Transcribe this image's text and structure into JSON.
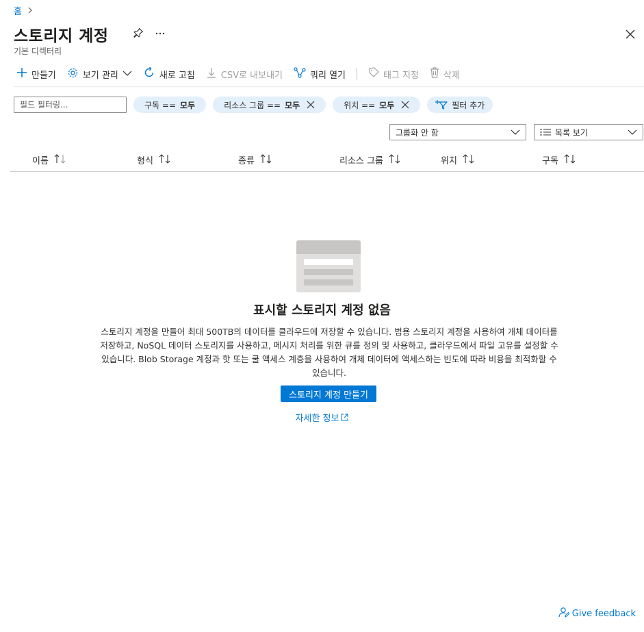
{
  "breadcrumb": {
    "home": "홈"
  },
  "header": {
    "title": "스토리지 계정",
    "subtitle": "기본 디렉터리"
  },
  "toolbar": {
    "create": "만들기",
    "manage_view": "보기 관리",
    "refresh": "새로 고침",
    "export_csv": "CSV로 내보내기",
    "open_query": "쿼리 열기",
    "assign_tags": "태그 지정",
    "delete": "삭제"
  },
  "filters": {
    "placeholder": "필드 필터링...",
    "pills": [
      {
        "key": "구독 ==",
        "value": "모두",
        "removable": false
      },
      {
        "key": "리소스 그룹 ==",
        "value": "모두",
        "removable": true
      },
      {
        "key": "위치 ==",
        "value": "모두",
        "removable": true
      }
    ],
    "add_filter": "필터 추가"
  },
  "grouping": {
    "selected": "그룹화 안 함"
  },
  "view_mode": {
    "selected": "목록 보기"
  },
  "table": {
    "columns": [
      "이름",
      "형식",
      "종류",
      "리소스 그룹",
      "위치",
      "구독"
    ]
  },
  "empty_state": {
    "title": "표시할 스토리지 계정 없음",
    "description": "스토리지 계정을 만들어 최대 500TB의 데이터를 클라우드에 저장할 수 있습니다. 범용 스토리지 계정을 사용하여 개체 데이터를 저장하고, NoSQL 데이터 스토리지를 사용하고, 메시지 처리를 위한 큐를 정의 및 사용하고, 클라우드에서 파일 고유를 설정할 수 있습니다. Blob Storage 계정과 핫 또는 쿨 액세스 계층을 사용하여 개체 데이터에 액세스하는 빈도에 따라 비용을 최적화할 수 있습니다.",
    "button": "스토리지 계정 만들기",
    "learn_more": "자세한 정보"
  },
  "feedback": "Give feedback",
  "colors": {
    "accent": "#0078d4",
    "pill_bg": "#e3effa",
    "disabled": "#a19f9d"
  }
}
